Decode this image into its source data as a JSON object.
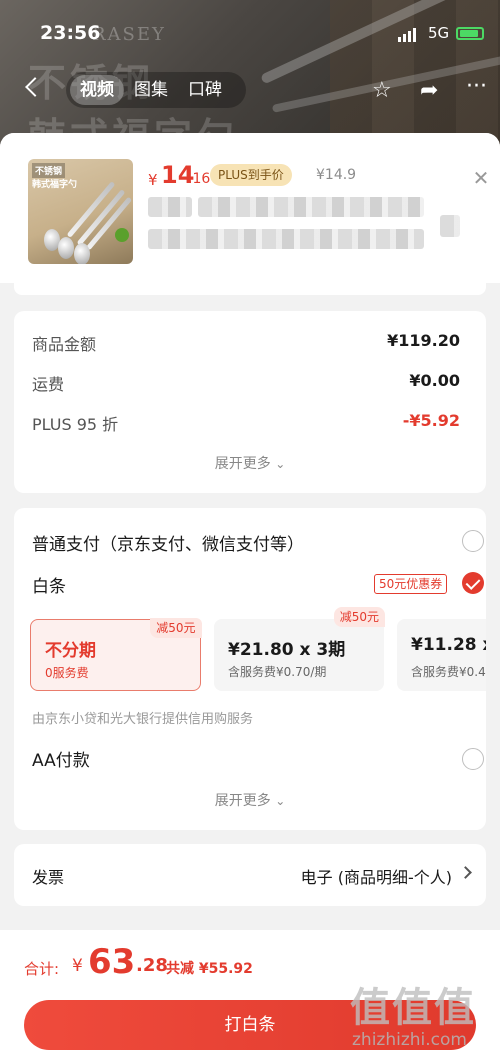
{
  "status_bar": {
    "time": "23:56",
    "network": "5G"
  },
  "nav": {
    "tabs": [
      {
        "label": "视频"
      },
      {
        "label": "图集"
      },
      {
        "label": "口碑"
      }
    ],
    "back_icon": "chevron-left-icon",
    "star_icon": "star-icon",
    "share_icon": "share-icon",
    "more_icon": "more-icon"
  },
  "backdrop": {
    "brand": "RASEY",
    "ghost_text": "不锈钢\n韩式福字勺"
  },
  "product": {
    "thumb_text_1": "不锈钢",
    "thumb_text_2": "韩式福字勺",
    "price_symbol": "¥",
    "price_int": "14",
    "price_dec": ".16",
    "plus_tag": "PLUS到手价",
    "original_price": "¥14.9"
  },
  "summary": {
    "rows": [
      {
        "label": "商品金额",
        "value": "¥119.20"
      },
      {
        "label": "运费",
        "value": "¥0.00"
      },
      {
        "label": "PLUS 95 折",
        "value": "-¥5.92"
      }
    ],
    "expand_label": "展开更多"
  },
  "payment": {
    "options": [
      {
        "label": "普通支付（京东支付、微信支付等）"
      },
      {
        "label": "白条"
      }
    ],
    "coupon": "50元优惠券",
    "plans": [
      {
        "title": "不分期",
        "sub": "0服务费",
        "badge": "减50元"
      },
      {
        "title": "¥21.80 x 3期",
        "sub": "含服务费¥0.70/期",
        "badge": "减50元"
      },
      {
        "title": "¥11.28 x 6",
        "sub": "含服务费¥0.4"
      }
    ],
    "provider_note": "由京东小贷和光大银行提供信用购服务",
    "aa_label": "AA付款",
    "expand_label": "展开更多"
  },
  "invoice": {
    "label": "发票",
    "value": "电子 (商品明细-个人)"
  },
  "footer": {
    "total_label": "合计:",
    "total_symbol": "¥",
    "total_int": "63",
    "total_dec": ".28",
    "saving": "共减 ¥55.92",
    "button": "打白条"
  },
  "watermark": {
    "glyphs": "值值值",
    "url": "zhizhizhi.com"
  },
  "colors": {
    "accent": "#e33b2e",
    "plus_gold": "#f7e3b5",
    "sheet_bg": "#f2f2f2"
  }
}
